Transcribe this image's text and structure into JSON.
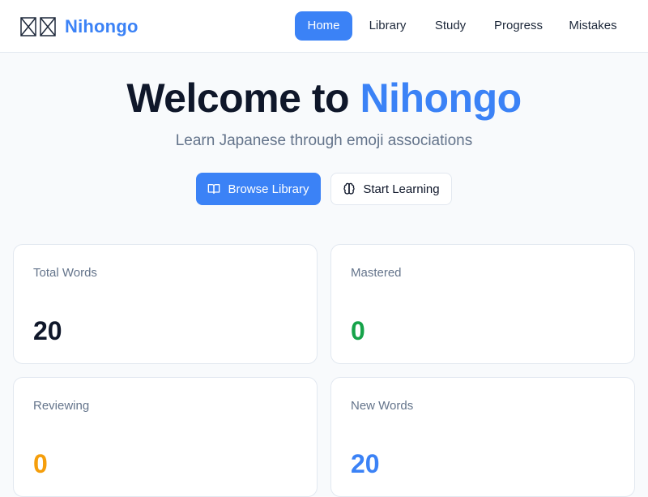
{
  "brand": {
    "name": "Nihongo",
    "logo_icon": "missing-glyph-boxes",
    "color": "#3b82f6"
  },
  "nav": {
    "items": [
      {
        "label": "Home",
        "active": true
      },
      {
        "label": "Library",
        "active": false
      },
      {
        "label": "Study",
        "active": false
      },
      {
        "label": "Progress",
        "active": false
      },
      {
        "label": "Mistakes",
        "active": false
      }
    ]
  },
  "hero": {
    "title_prefix": "Welcome to",
    "title_accent": "Nihongo",
    "subtitle": "Learn Japanese through emoji associations",
    "primary_button": {
      "label": "Browse Library",
      "icon": "book-open-icon"
    },
    "secondary_button": {
      "label": "Start Learning",
      "icon": "brain-icon"
    }
  },
  "stats": [
    {
      "label": "Total Words",
      "value": "20",
      "color": "#0f172a"
    },
    {
      "label": "Mastered",
      "value": "0",
      "color": "#16a34a"
    },
    {
      "label": "Reviewing",
      "value": "0",
      "color": "#f59e0b"
    },
    {
      "label": "New Words",
      "value": "20",
      "color": "#3b82f6"
    }
  ],
  "colors": {
    "accent": "#3b82f6",
    "background": "#f8fafc",
    "muted_text": "#64748b",
    "border": "#e2e8f0"
  }
}
